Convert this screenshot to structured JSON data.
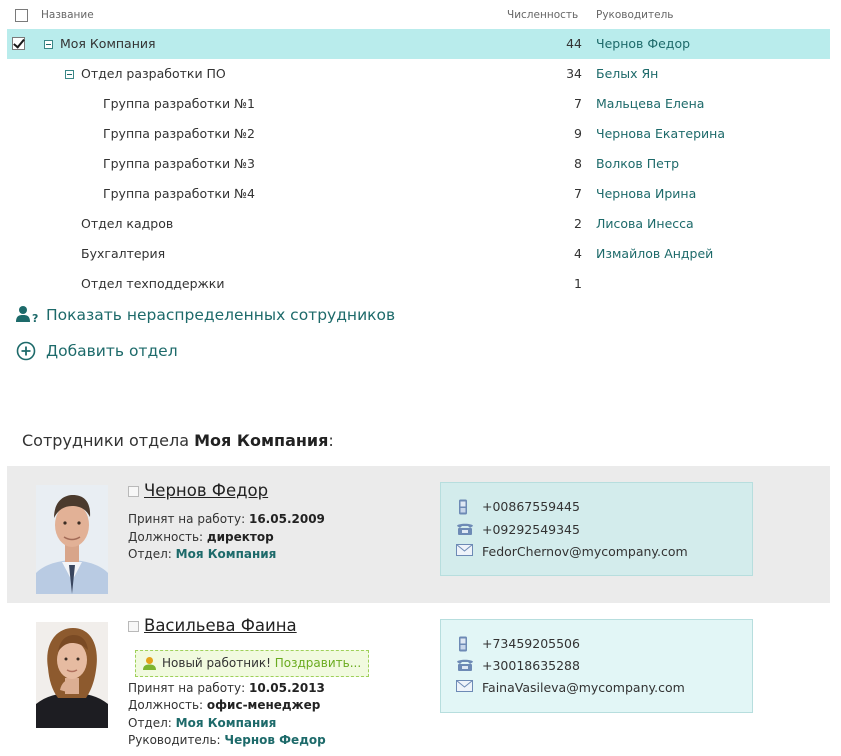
{
  "tree": {
    "columns": {
      "name": "Название",
      "count": "Численность",
      "head": "Руководитель"
    },
    "rows": [
      {
        "name": "Моя Компания",
        "count": "44",
        "head": "Чернов Федор",
        "level": 0,
        "expanded": true,
        "selected": true
      },
      {
        "name": "Отдел разработки ПО",
        "count": "34",
        "head": "Белых Ян",
        "level": 1,
        "expanded": true,
        "selected": false
      },
      {
        "name": "Группа разработки №1",
        "count": "7",
        "head": "Мальцева Елена",
        "level": 2,
        "selected": false
      },
      {
        "name": "Группа разработки №2",
        "count": "9",
        "head": "Чернова Екатерина",
        "level": 2,
        "selected": false
      },
      {
        "name": "Группа разработки №3",
        "count": "8",
        "head": "Волков Петр",
        "level": 2,
        "selected": false
      },
      {
        "name": "Группа разработки №4",
        "count": "7",
        "head": "Чернова Ирина",
        "level": 2,
        "selected": false
      },
      {
        "name": "Отдел кадров",
        "count": "2",
        "head": "Лисова Инесса",
        "level": 1,
        "selected": false
      },
      {
        "name": "Бухгалтерия",
        "count": "4",
        "head": "Измайлов Андрей",
        "level": 1,
        "selected": false
      },
      {
        "name": "Отдел техподдержки",
        "count": "1",
        "head": "",
        "level": 1,
        "selected": false
      }
    ]
  },
  "actions": {
    "show_unassigned": "Показать нераспределенных сотрудников",
    "add_department": "Добавить отдел"
  },
  "employees_section": {
    "title_prefix": "Сотрудники отдела ",
    "department": "Моя Компания",
    "title_suffix": ":"
  },
  "employees": [
    {
      "name": "Чернов Федор",
      "hired_label": "Принят на работу: ",
      "hired": "16.05.2009",
      "position_label": "Должность: ",
      "position": "директор",
      "department_label": "Отдел: ",
      "department": "Моя Компания",
      "mobile": "+00867559445",
      "phone": "+09292549345",
      "email": "FedorChernov@mycompany.com"
    },
    {
      "name": "Васильева Фаина",
      "badge_text": "Новый работник! ",
      "badge_link": "Поздравить...",
      "hired_label": "Принят на работу: ",
      "hired": "10.05.2013",
      "position_label": "Должность: ",
      "position": "офис-менеджер",
      "department_label": "Отдел: ",
      "department": "Моя Компания",
      "manager_label": "Руководитель: ",
      "manager": "Чернов Федор",
      "mobile": "+73459205506",
      "phone": "+30018635288",
      "email": "FainaVasileva@mycompany.com"
    }
  ],
  "colors": {
    "accent": "#1d6a6a",
    "selected_row": "#b9ecec",
    "card_bg": "#ebebeb",
    "contacts_bg": "#d3ecec",
    "badge_green": "#6aab1f"
  },
  "icons": {
    "collapse": "minus-box-icon",
    "unassigned": "user-question-icon",
    "add": "plus-circle-icon",
    "mobile": "mobile-phone-icon",
    "phone": "desk-phone-icon",
    "email": "envelope-icon",
    "new_employee": "user-icon"
  }
}
